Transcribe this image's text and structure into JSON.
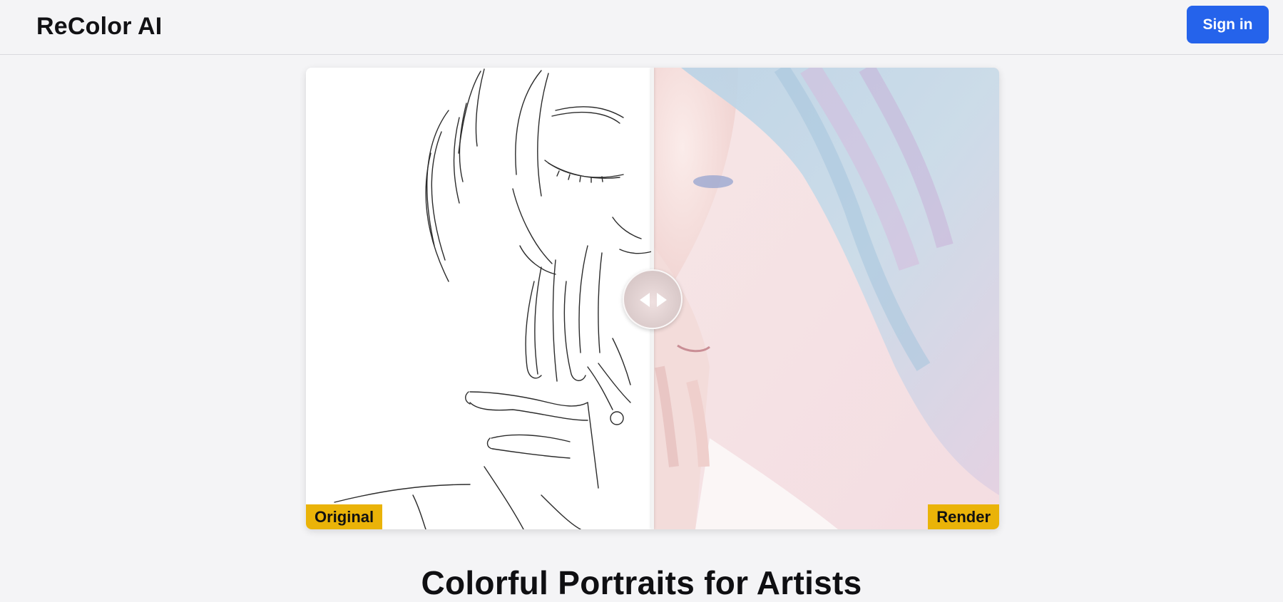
{
  "header": {
    "brand": "ReColor AI",
    "signin_label": "Sign in"
  },
  "compare": {
    "left_label": "Original",
    "right_label": "Render",
    "slider_position": 0.5,
    "handle_icon": "left-right-arrows-icon"
  },
  "hero": {
    "headline": "Colorful Portraits for Artists"
  },
  "colors": {
    "accent": "#2563eb",
    "tag": "#eab308",
    "background": "#f4f4f6"
  }
}
